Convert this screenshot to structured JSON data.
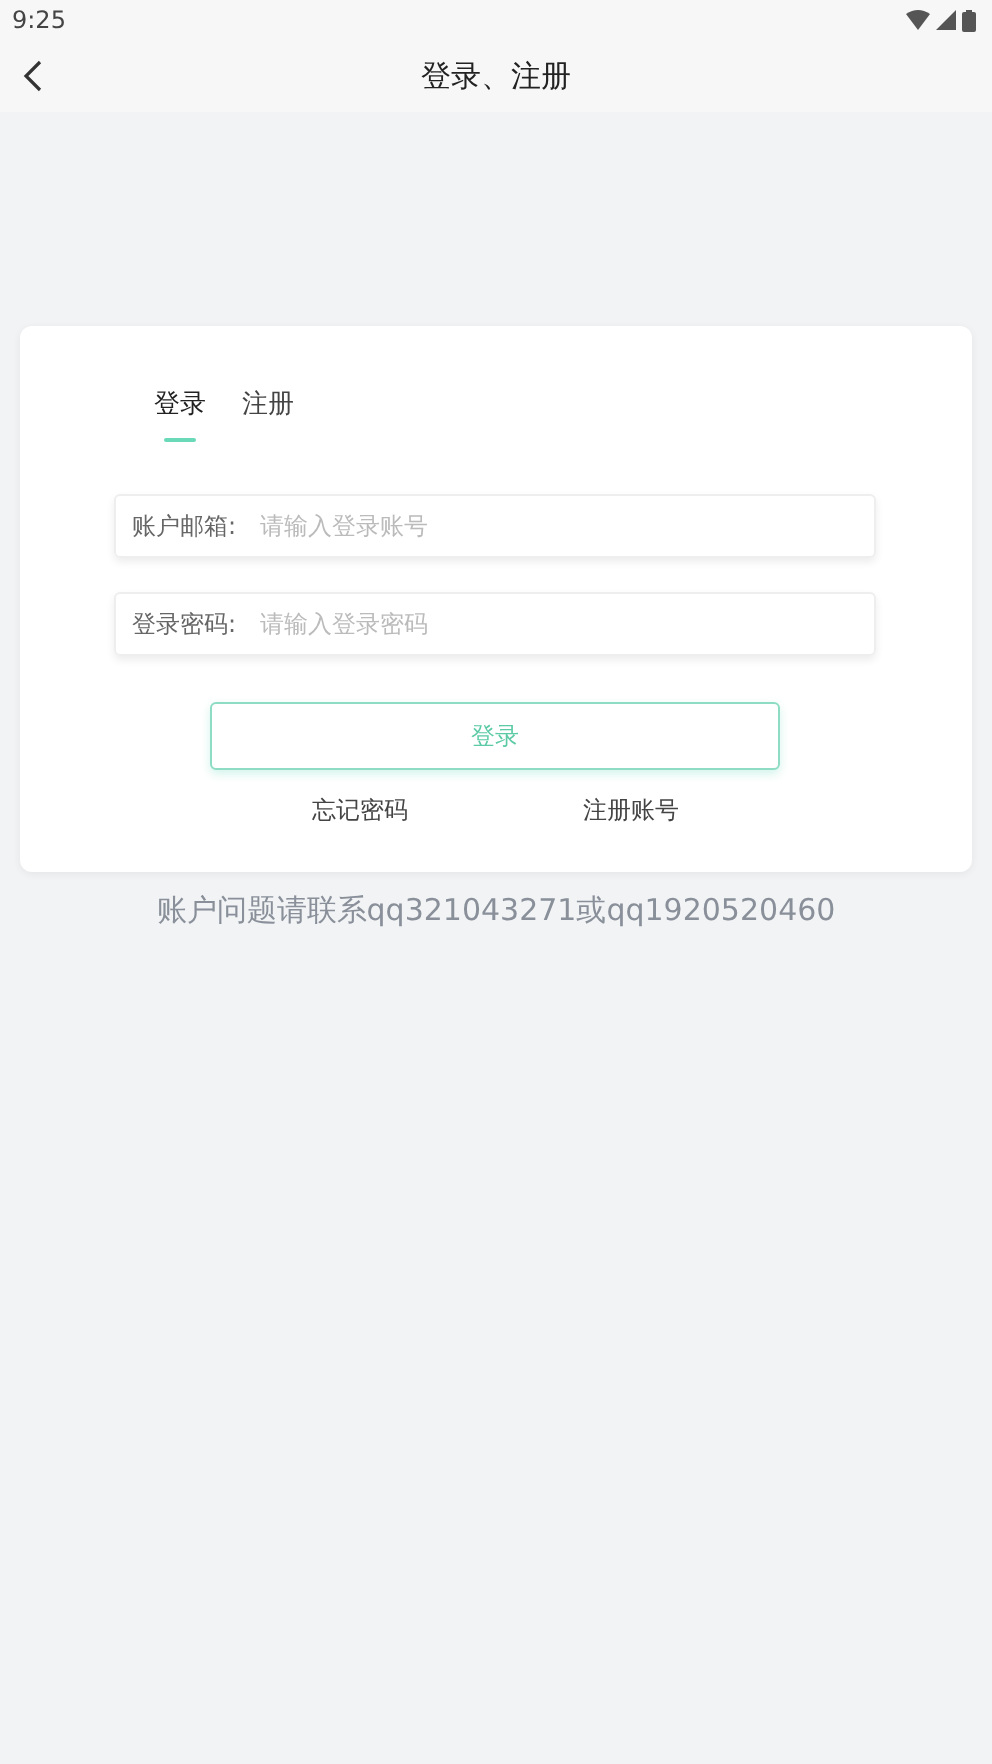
{
  "status_bar": {
    "time": "9:25"
  },
  "header": {
    "title": "登录、注册"
  },
  "tabs": [
    {
      "label": "登录",
      "selected": true
    },
    {
      "label": "注册",
      "selected": false
    }
  ],
  "fields": [
    {
      "label": "账户邮箱:",
      "placeholder": "请输入登录账号"
    },
    {
      "label": "登录密码:",
      "placeholder": "请输入登录密码"
    }
  ],
  "login_button": "登录",
  "links": [
    "忘记密码",
    "注册账号"
  ],
  "contact_note": "账户问题请联系qq321043271或qq1920520460"
}
